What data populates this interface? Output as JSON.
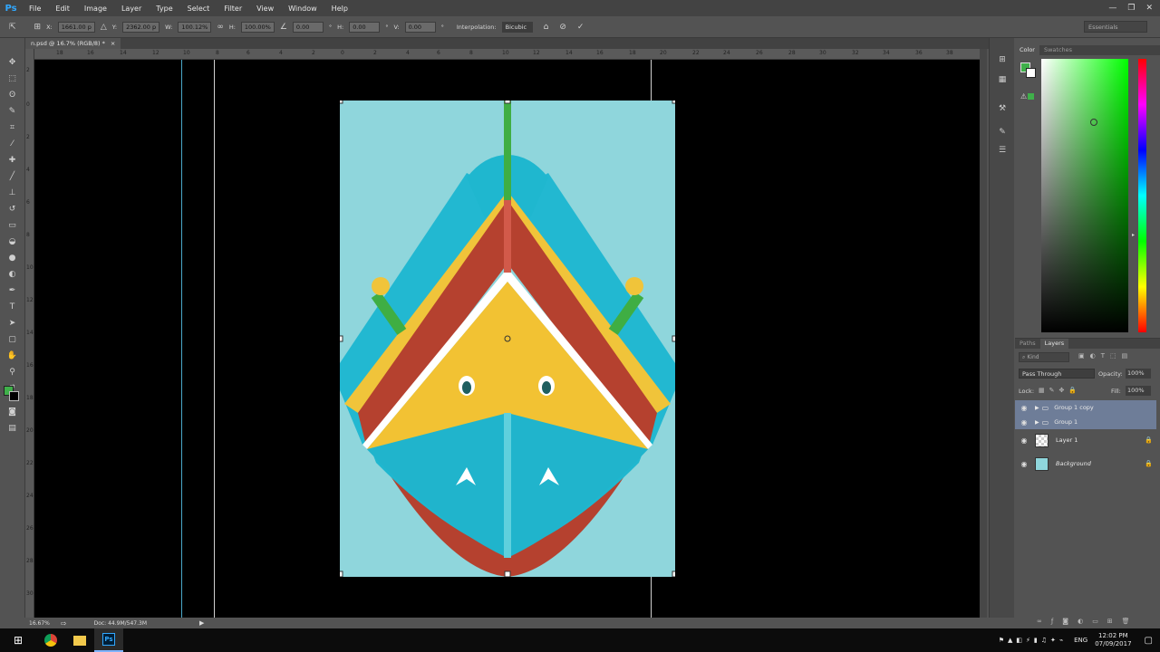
{
  "menubar": {
    "logo": "Ps",
    "items": [
      "File",
      "Edit",
      "Image",
      "Layer",
      "Type",
      "Select",
      "Filter",
      "View",
      "Window",
      "Help"
    ],
    "window_controls": [
      "—",
      "❐",
      "✕"
    ]
  },
  "options": {
    "x_label": "X:",
    "x_value": "1661.00 p",
    "y_label": "Y:",
    "y_value": "2362.00 p",
    "w_label": "W:",
    "w_value": "100.12%",
    "h_label": "H:",
    "h_value": "100.00%",
    "angle_value": "0.00",
    "angle_unit": "°",
    "hskew_label": "H:",
    "hskew_value": "0.00",
    "hskew_unit": "°",
    "vskew_label": "V:",
    "vskew_value": "0.00",
    "vskew_unit": "°",
    "interp_label": "Interpolation:",
    "interp_value": "Bicubic",
    "workspace": "Essentials"
  },
  "document": {
    "tab_label": "n.psd @ 16.7% (RGB/8) *",
    "tab_close": "×"
  },
  "rulers": {
    "top_labels": [
      "18",
      "16",
      "14",
      "12",
      "10",
      "8",
      "6",
      "4",
      "2",
      "0",
      "2",
      "4",
      "6",
      "8",
      "10",
      "12",
      "14",
      "16",
      "18",
      "20",
      "22",
      "24",
      "26",
      "28",
      "30",
      "32",
      "34",
      "36",
      "38"
    ],
    "left_labels": [
      "2",
      "0",
      "2",
      "4",
      "6",
      "8",
      "10",
      "12",
      "14",
      "16",
      "18",
      "20",
      "22",
      "24",
      "26",
      "28",
      "30"
    ]
  },
  "status": {
    "zoom": "16.67%",
    "doc": "Doc: 44.9M/547.3M"
  },
  "color_panel": {
    "tabs": [
      "Color",
      "Swatches"
    ],
    "foreground": "#3fb04a",
    "background": "#ffffff",
    "spectrum_hue": "#00ff00"
  },
  "layers_panel": {
    "tabs": [
      "Paths",
      "Layers"
    ],
    "kind_placeholder": "Kind",
    "blend_mode": "Pass Through",
    "opacity_label": "Opacity:",
    "opacity_value": "100%",
    "lock_label": "Lock:",
    "fill_label": "Fill:",
    "fill_value": "100%",
    "layers": [
      {
        "name": "Group 1 copy",
        "type": "group",
        "selected": true
      },
      {
        "name": "Group 1",
        "type": "group",
        "selected": true
      },
      {
        "name": "Layer 1",
        "type": "layer",
        "selected": false
      },
      {
        "name": "Background",
        "type": "background",
        "selected": false
      }
    ]
  },
  "taskbar": {
    "lang": "ENG",
    "time": "12:02 PM",
    "date": "07/09/2017"
  },
  "colors": {
    "boat_sky": "#8fd6dc",
    "boat_turquoise": "#1fb7cf",
    "boat_red": "#b5412f",
    "boat_yellow": "#f2c233",
    "boat_green": "#3fae43"
  }
}
